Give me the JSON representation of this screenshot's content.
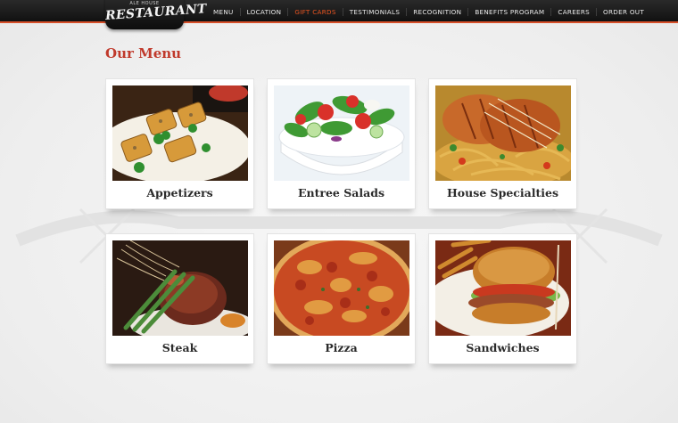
{
  "brand": {
    "small_text": "ALE HOUSE",
    "name": "RESTAURANT"
  },
  "nav": {
    "items": [
      {
        "label": "MENU",
        "active": false
      },
      {
        "label": "LOCATION",
        "active": false
      },
      {
        "label": "GIFT CARDS",
        "active": true
      },
      {
        "label": "TESTIMONIALS",
        "active": false
      },
      {
        "label": "RECOGNITION",
        "active": false
      },
      {
        "label": "BENEFITS PROGRAM",
        "active": false
      },
      {
        "label": "CAREERS",
        "active": false
      },
      {
        "label": "ORDER OUT",
        "active": false
      }
    ]
  },
  "page": {
    "title": "Our Menu"
  },
  "menu": {
    "cards": [
      {
        "label": "Appetizers",
        "image": "appetizers-photo"
      },
      {
        "label": "Entree Salads",
        "image": "salad-photo"
      },
      {
        "label": "House Specialties",
        "image": "chicken-pasta-photo"
      },
      {
        "label": "Steak",
        "image": "steak-photo"
      },
      {
        "label": "Pizza",
        "image": "pizza-photo"
      },
      {
        "label": "Sandwiches",
        "image": "sandwich-photo"
      }
    ]
  },
  "colors": {
    "accent": "#e8531f",
    "title": "#c0392b",
    "nav_bg": "#111111"
  }
}
